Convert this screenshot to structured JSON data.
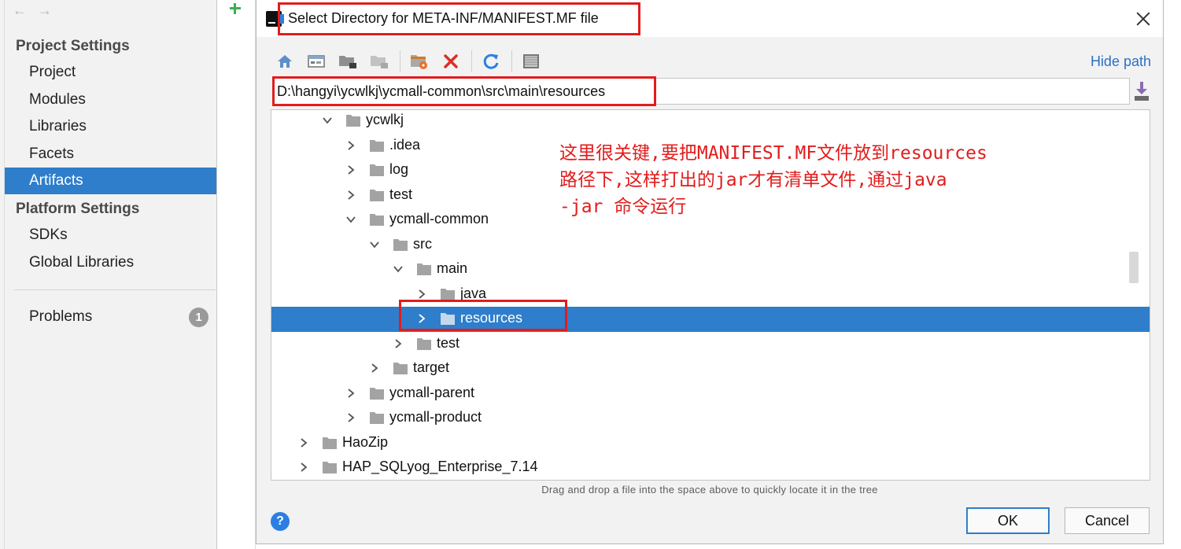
{
  "sidebar": {
    "project_settings": "Project Settings",
    "platform_settings": "Platform Settings",
    "items": [
      {
        "label": "Project"
      },
      {
        "label": "Modules"
      },
      {
        "label": "Libraries"
      },
      {
        "label": "Facets"
      },
      {
        "label": "Artifacts",
        "selected": true
      }
    ],
    "platform_items": [
      {
        "label": "SDKs"
      },
      {
        "label": "Global Libraries"
      }
    ],
    "problems": {
      "label": "Problems",
      "count": "1"
    }
  },
  "dialog": {
    "title": "Select Directory for META-INF/MANIFEST.MF file",
    "hide_path": "Hide path",
    "path": "D:\\hangyi\\ycwlkj\\ycmall-common\\src\\main\\resources",
    "toolbar": [
      "home-icon",
      "desktop-icon",
      "new-folder-icon",
      "new-folder-disabled-icon",
      "refresh-folder-icon",
      "delete-icon",
      "refresh-icon",
      "show-hidden-icon"
    ],
    "tree": [
      {
        "label": "ycwlkj",
        "expanded": true
      },
      {
        "label": ".idea",
        "expanded": false
      },
      {
        "label": "log",
        "expanded": false
      },
      {
        "label": "test",
        "expanded": false
      },
      {
        "label": "ycmall-common",
        "expanded": true
      },
      {
        "label": "src",
        "expanded": true
      },
      {
        "label": "main",
        "expanded": true
      },
      {
        "label": "java",
        "expanded": false
      },
      {
        "label": "resources",
        "expanded": false,
        "selected": true
      },
      {
        "label": "test",
        "expanded": false
      },
      {
        "label": "target",
        "expanded": false
      },
      {
        "label": "ycmall-parent",
        "expanded": false
      },
      {
        "label": "ycmall-product",
        "expanded": false
      },
      {
        "label": "HaoZip",
        "expanded": false
      },
      {
        "label": "HAP_SQLyog_Enterprise_7.14",
        "expanded": false
      }
    ],
    "annotation": [
      "这里很关键,要把MANIFEST.MF文件放到resources",
      "路径下,这样打出的jar才有清单文件,通过java",
      "-jar 命令运行"
    ],
    "hint": "Drag and drop a file into the space above to quickly locate it in the tree",
    "ok": "OK",
    "cancel": "Cancel",
    "help": "?"
  },
  "colors": {
    "selection": "#2e7ecb",
    "annotation": "#e21c1c",
    "link": "#2c6fc6"
  }
}
